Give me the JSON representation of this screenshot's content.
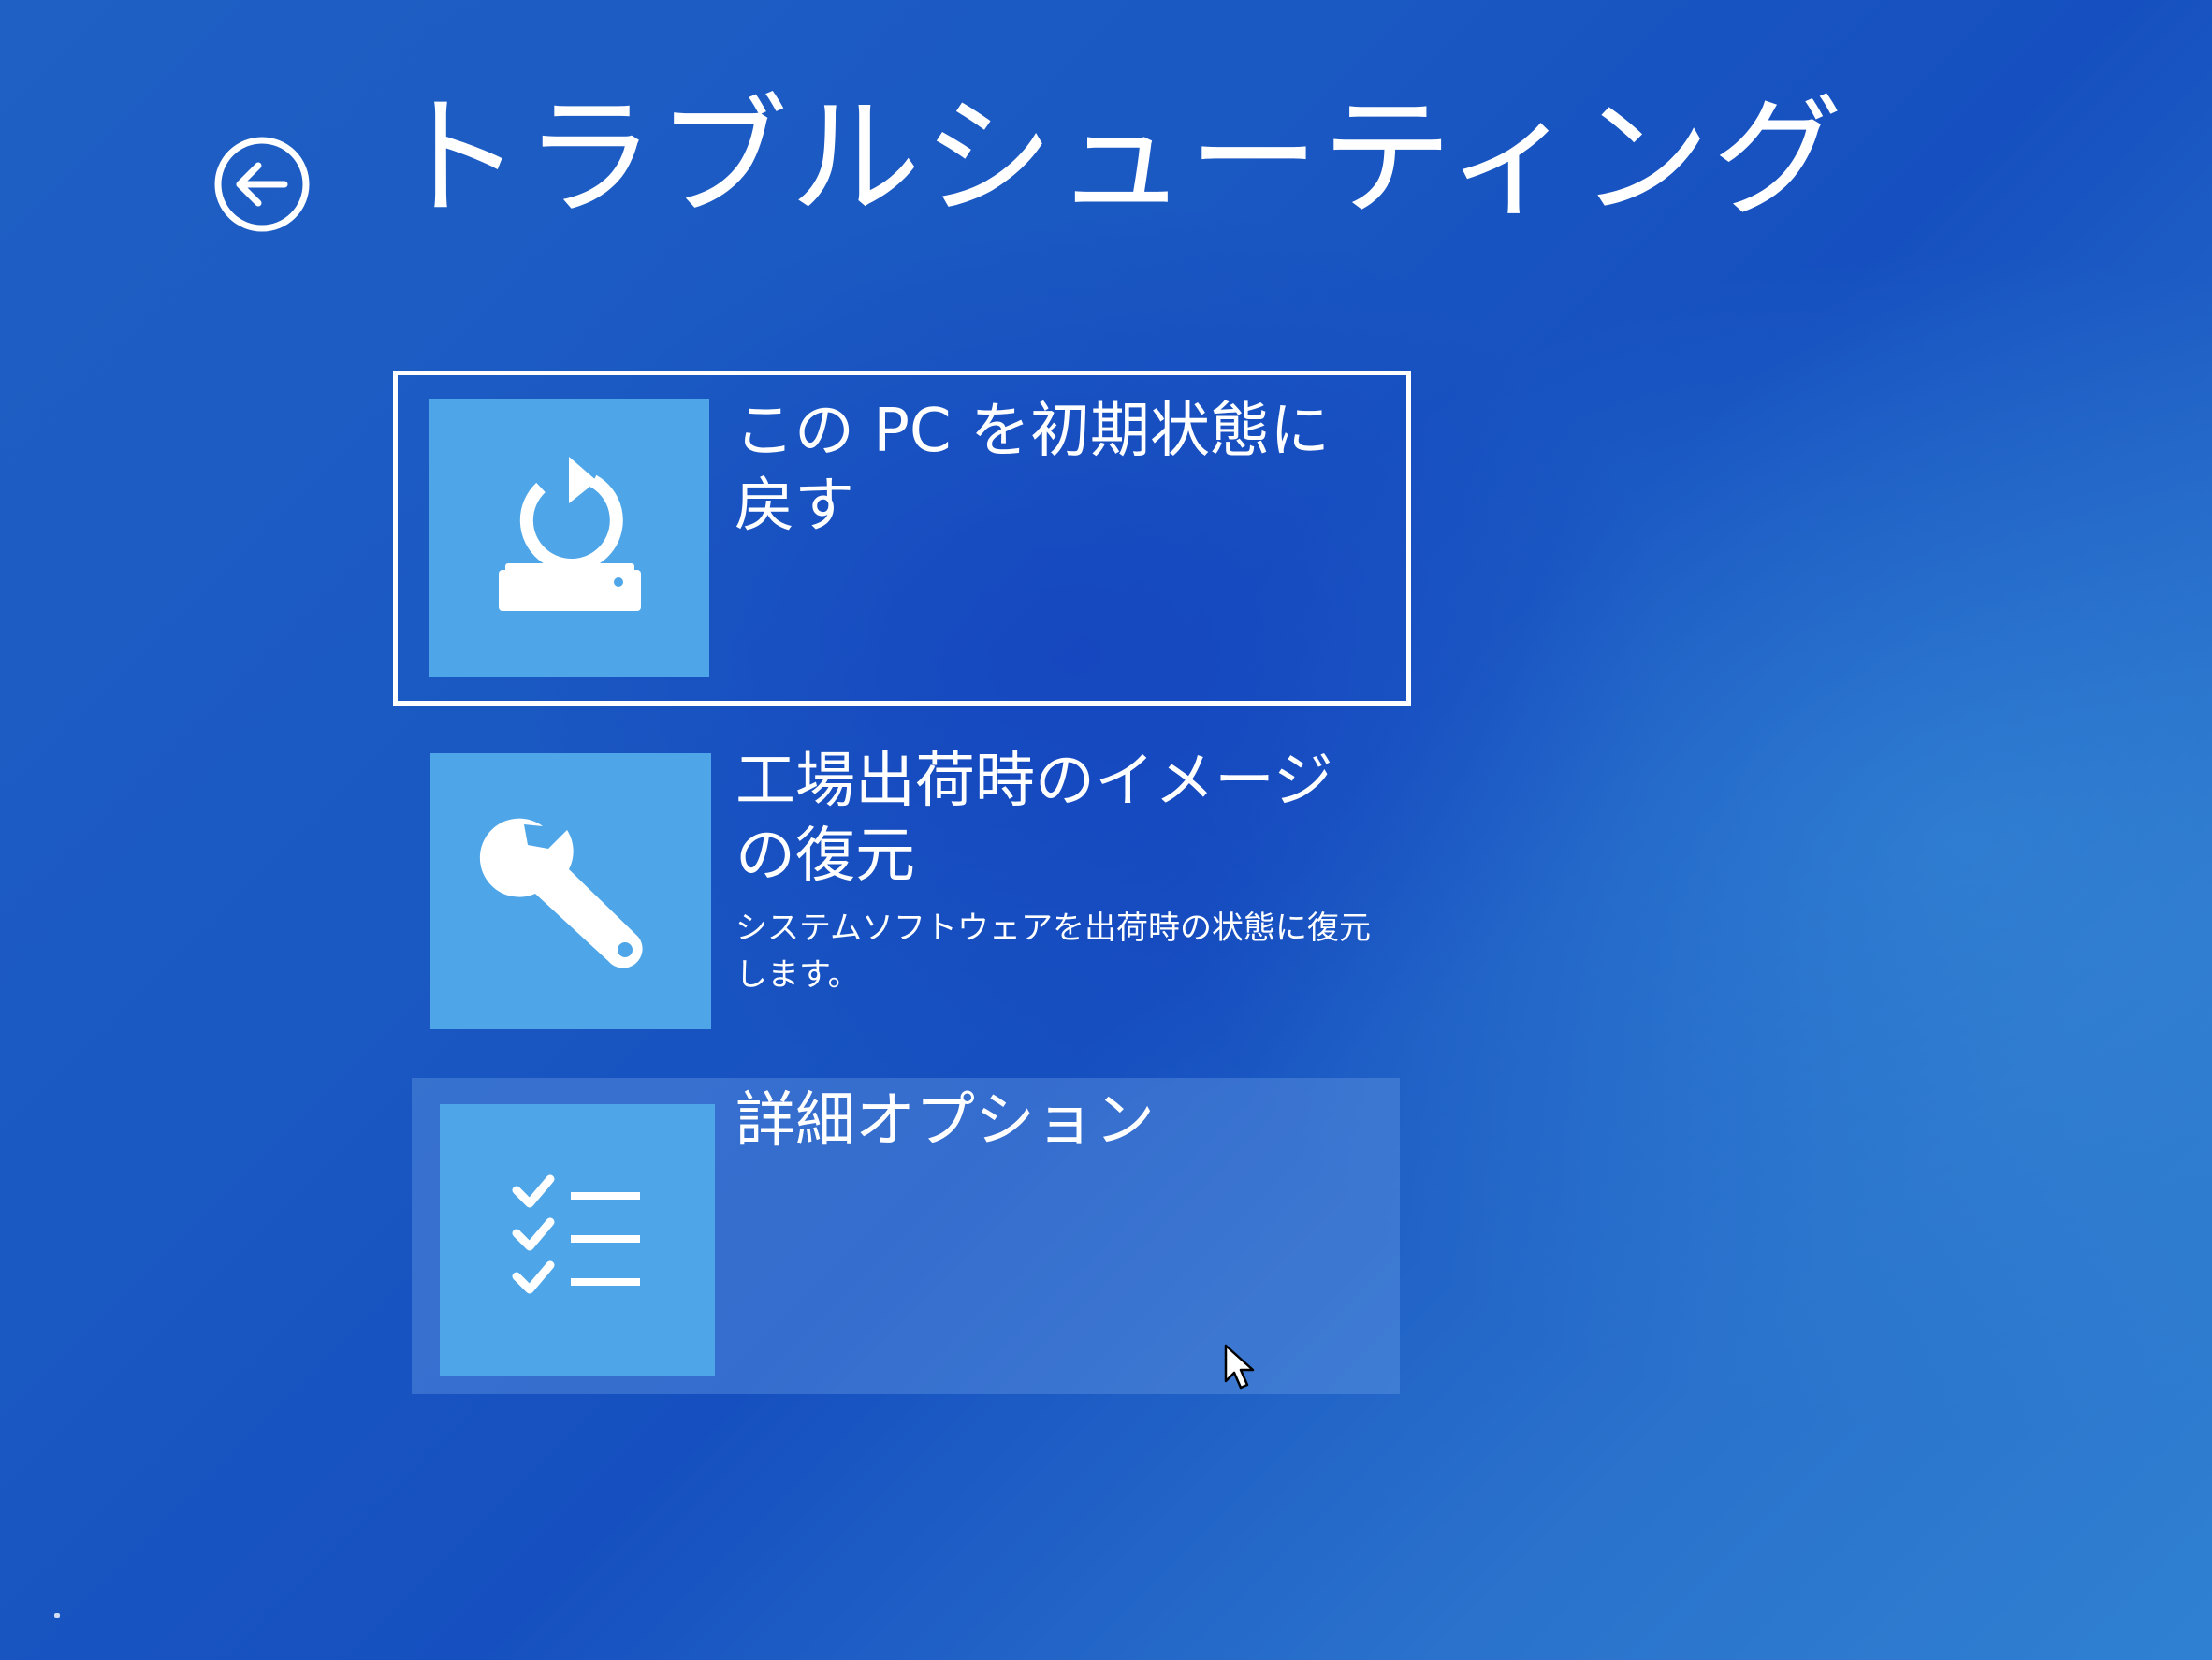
{
  "header": {
    "title": "トラブルシューティング",
    "back_icon": "back-arrow-circle-icon"
  },
  "options": [
    {
      "label": "この PC を初期状態に戻す",
      "description": "",
      "icon": "reset-pc-icon",
      "state": "focused"
    },
    {
      "label": "工場出荷時のイメージの復元",
      "description": "システムソフトウェアを出荷時の状態に復元します。",
      "icon": "wrench-icon",
      "state": "normal"
    },
    {
      "label": "詳細オプション",
      "description": "",
      "icon": "checklist-icon",
      "state": "hover"
    }
  ],
  "colors": {
    "background": "#1a58c2",
    "tile": "#4ea6e8",
    "text": "#ffffff"
  }
}
